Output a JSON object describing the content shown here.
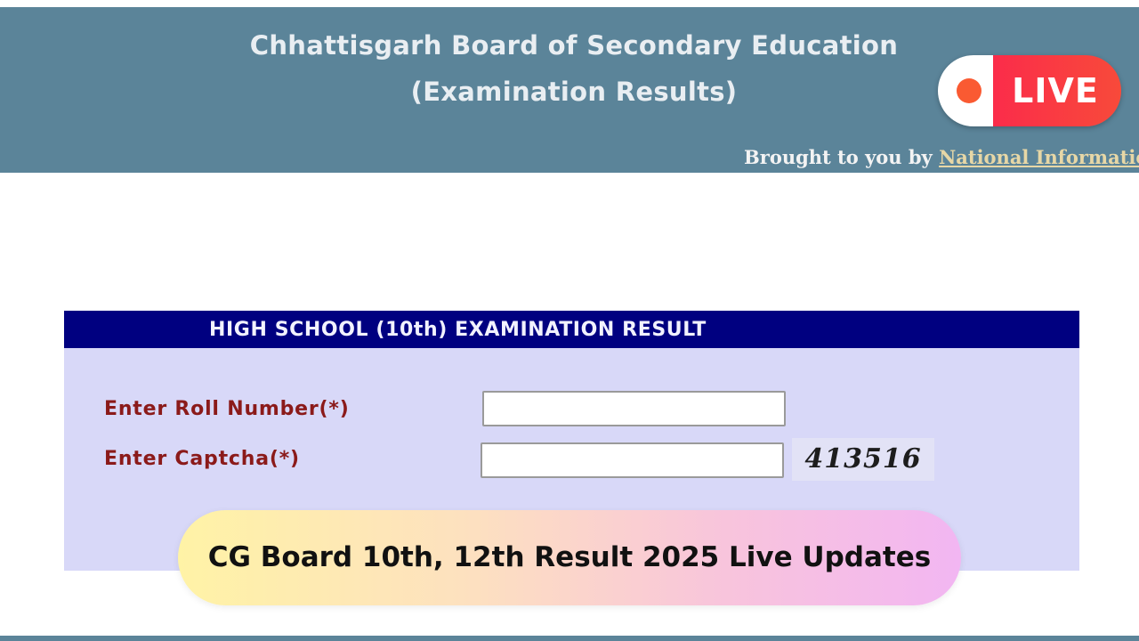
{
  "header": {
    "title": "Chhattisgarh Board of Secondary Education",
    "subtitle": "(Examination Results)",
    "brought_by_prefix": "Brought to you by",
    "brought_by_link": "National Informatics C",
    "background_color": "#5b8499"
  },
  "live_badge": {
    "label": "LIVE",
    "dot_color": "#fa5a32",
    "badge_color": "#fb2c4a",
    "icon": "record-dot-icon"
  },
  "form": {
    "title": "HIGH SCHOOL (10th) EXAMINATION RESULT",
    "header_color": "#000080",
    "panel_color": "#d8d8f8",
    "roll_number": {
      "label": "Enter Roll Number(*)",
      "value": ""
    },
    "captcha": {
      "label": "Enter Captcha(*)",
      "value": "",
      "code": "413516"
    },
    "label_color": "#8b1a1a"
  },
  "banner": {
    "text": "CG Board 10th, 12th Result 2025 Live Updates"
  }
}
